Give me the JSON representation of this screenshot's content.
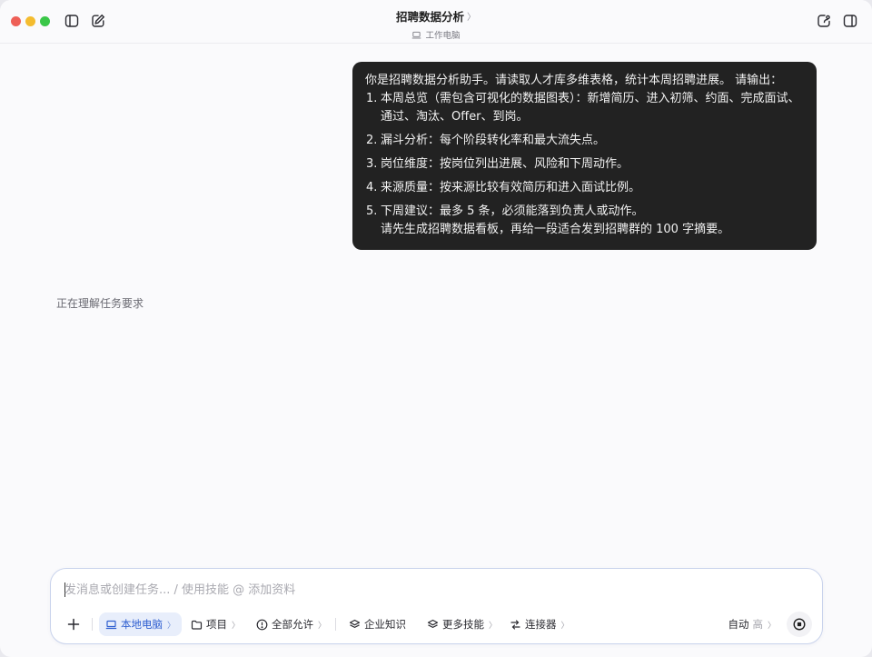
{
  "window": {
    "title": "招聘数据分析",
    "subtitle": "工作电脑"
  },
  "conversation": {
    "user_message": {
      "intro": "你是招聘数据分析助手。请读取人才库多维表格，统计本周招聘进展。 请输出：",
      "items": [
        {
          "num": "1.",
          "text": "本周总览（需包含可视化的数据图表）：新增简历、进入初筛、约面、完成面试、通过、淘汰、Offer、到岗。"
        },
        {
          "num": "2.",
          "text": "漏斗分析：每个阶段转化率和最大流失点。"
        },
        {
          "num": "3.",
          "text": "岗位维度：按岗位列出进展、风险和下周动作。"
        },
        {
          "num": "4.",
          "text": "来源质量：按来源比较有效简历和进入面试比例。"
        },
        {
          "num": "5.",
          "text": "下周建议：最多 5 条，必须能落到负责人或动作。"
        }
      ],
      "trailer": "请先生成招聘数据看板，再给一段适合发到招聘群的 100 字摘要。"
    },
    "status": "正在理解任务要求"
  },
  "composer": {
    "placeholder": "发消息或创建任务... / 使用技能 @ 添加资料",
    "value": "",
    "buttons": {
      "local_computer": "本地电脑",
      "project": "项目",
      "permission": "全部允许",
      "enterprise_knowledge": "企业知识",
      "more_skills": "更多技能",
      "connectors": "连接器",
      "mode": "自动",
      "level": "高"
    }
  },
  "colors": {
    "bubble_bg": "#222222",
    "accent": "#2f5fd0",
    "traffic_red": "#ee5f57",
    "traffic_yellow": "#f4bc2f",
    "traffic_green": "#3ac748"
  }
}
